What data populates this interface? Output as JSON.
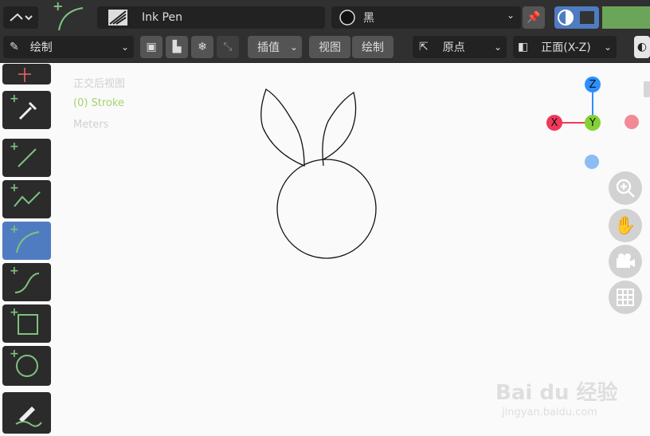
{
  "header": {
    "brush_name": "Ink Pen",
    "material_name": "黑"
  },
  "toolbar_row": {
    "mode_label": "绘制",
    "interpolate_label": "插值",
    "view_menu_label": "视图",
    "draw_menu_label": "绘制",
    "origin_label": "原点",
    "view_orient_label": "正面(X-Z)"
  },
  "viewport": {
    "view_name": "正交后视图",
    "object_info": "(0) Stroke",
    "units": "Meters"
  },
  "gizmo": {
    "z_label": "Z",
    "x_label": "X",
    "y_label": "Y"
  },
  "watermark": {
    "brand": "Bai du 经验",
    "url": "jingyan.baidu.com"
  },
  "colors": {
    "active_tool": "#4f7cc0",
    "x_axis": "#f0385a",
    "y_axis": "#82d233",
    "z_axis": "#2c8fff",
    "object_info": "#a5d36b"
  },
  "icons": [
    "grease-pencil-mode-icon",
    "arc-tool-icon",
    "brush-icon",
    "material-sphere-icon",
    "pin-icon",
    "overlay-icon",
    "pencil-icon",
    "eyedropper-icon",
    "line-icon",
    "polyline-icon",
    "arc-icon",
    "curve-icon",
    "box-icon",
    "circle-icon",
    "zoom-icon",
    "hand-icon",
    "camera-icon",
    "grid-icon"
  ]
}
